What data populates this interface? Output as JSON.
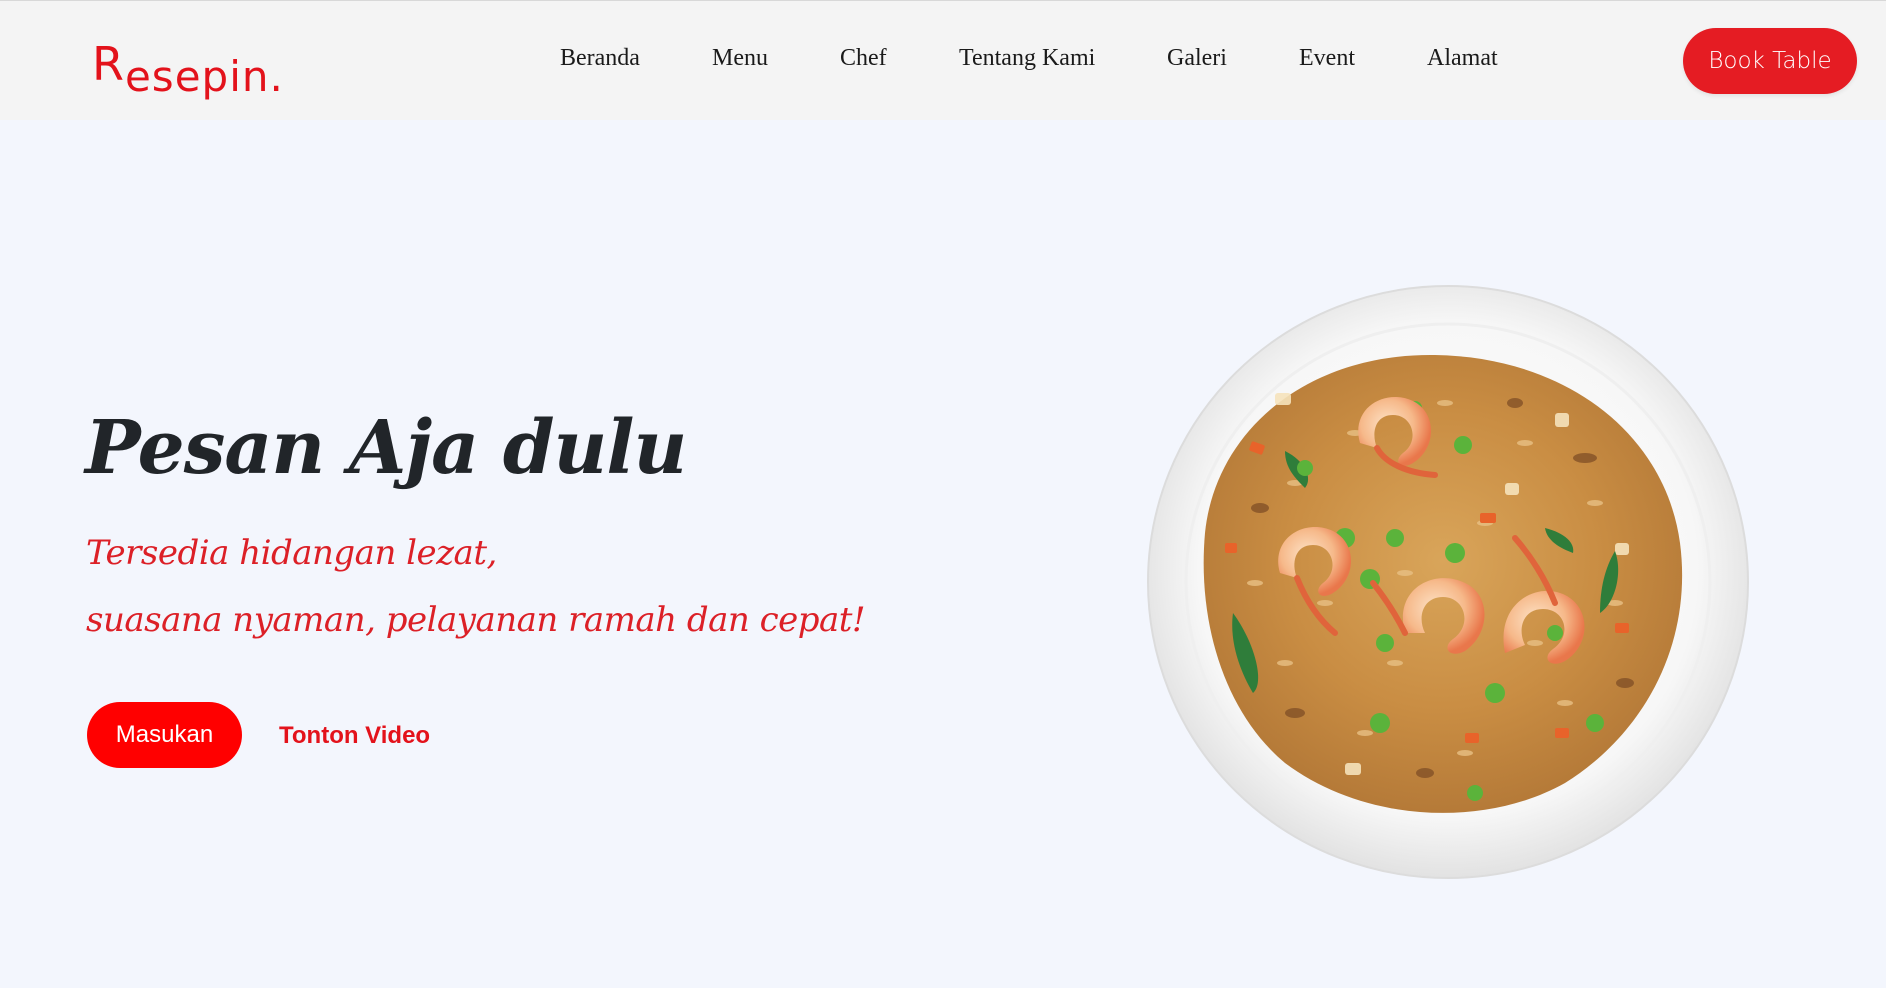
{
  "header": {
    "logo_first": "R",
    "logo_rest": "esepin.",
    "nav": [
      {
        "label": "Beranda"
      },
      {
        "label": "Menu"
      },
      {
        "label": "Chef"
      },
      {
        "label": "Tentang Kami"
      },
      {
        "label": "Galeri"
      },
      {
        "label": "Event"
      },
      {
        "label": "Alamat"
      }
    ],
    "book_label": "Book Table"
  },
  "hero": {
    "title": "Pesan Aja dulu",
    "subtitle_line1": "Tersedia hidangan lezat,",
    "subtitle_line2": "suasana nyaman, pelayanan ramah dan cepat!",
    "primary_button": "Masukan",
    "secondary_link": "Tonton Video",
    "image": "fried-rice-with-shrimp-plate"
  },
  "colors": {
    "accent": "#e51c23",
    "button_red": "#ff0000",
    "background": "#f3f6fd",
    "header_bg": "#f4f4f4",
    "title": "#212529"
  }
}
